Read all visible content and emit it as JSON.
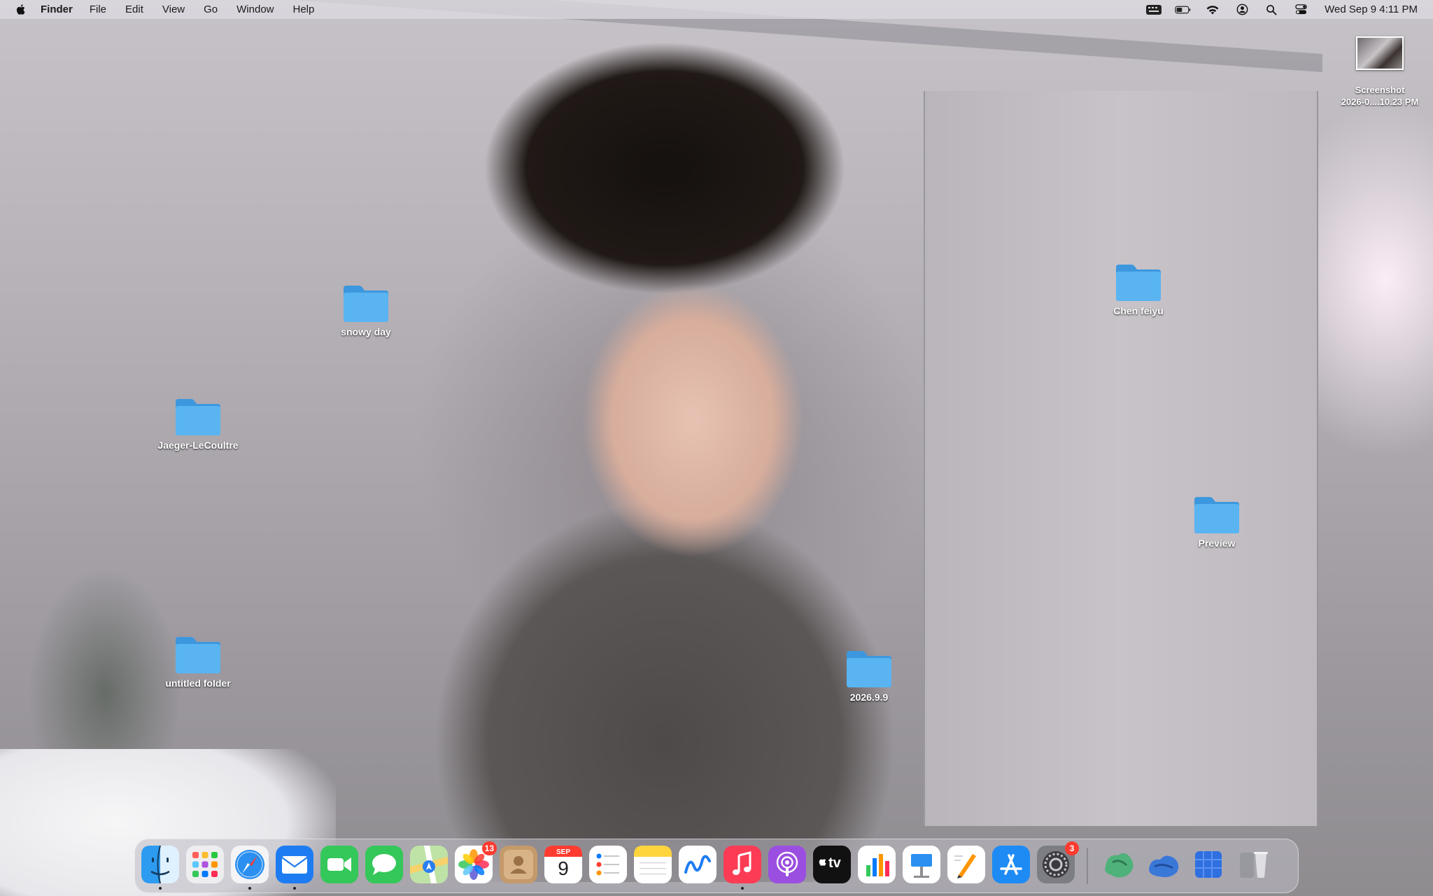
{
  "menubar": {
    "apple_icon": "apple-logo-icon",
    "app_name": "Finder",
    "menus": [
      "File",
      "Edit",
      "View",
      "Go",
      "Window",
      "Help"
    ],
    "status_icons": [
      "keyboard-input-icon",
      "battery-icon",
      "wifi-icon",
      "user-icon",
      "spotlight-search-icon",
      "control-center-icon"
    ],
    "clock": "Wed Sep 9  4:11 PM"
  },
  "desktop": {
    "items": [
      {
        "label": "snowy day",
        "kind": "folder"
      },
      {
        "label": "Jaeger-LeCoultre",
        "kind": "folder"
      },
      {
        "label": "untitled folder",
        "kind": "folder"
      },
      {
        "label": "2026.9.9",
        "kind": "folder"
      },
      {
        "label": "Chen feiyu",
        "kind": "folder"
      },
      {
        "label": "Preview",
        "kind": "folder"
      },
      {
        "label": "Screenshot",
        "label_line2": "2026-0....10.23 PM",
        "kind": "image"
      }
    ]
  },
  "dock": {
    "apps": [
      {
        "name": "finder-icon",
        "running": true
      },
      {
        "name": "launchpad-icon",
        "running": false
      },
      {
        "name": "safari-icon",
        "running": true
      },
      {
        "name": "mail-icon",
        "running": true
      },
      {
        "name": "facetime-icon",
        "running": false
      },
      {
        "name": "messages-icon",
        "running": false
      },
      {
        "name": "maps-icon",
        "running": false
      },
      {
        "name": "photos-icon",
        "running": false,
        "badge": "13"
      },
      {
        "name": "contacts-icon",
        "running": false
      },
      {
        "name": "calendar-icon",
        "running": false,
        "month": "SEP",
        "day": "9"
      },
      {
        "name": "reminders-icon",
        "running": false
      },
      {
        "name": "notes-icon",
        "running": false
      },
      {
        "name": "freeform-icon",
        "running": false
      },
      {
        "name": "music-icon",
        "running": true
      },
      {
        "name": "podcasts-icon",
        "running": false
      },
      {
        "name": "apple-tv-icon",
        "running": false,
        "text": "tv"
      },
      {
        "name": "numbers-icon",
        "running": false
      },
      {
        "name": "keynote-icon",
        "running": false
      },
      {
        "name": "pages-icon",
        "running": false
      },
      {
        "name": "app-store-icon",
        "running": false
      },
      {
        "name": "system-settings-icon",
        "running": false,
        "badge": "3"
      },
      {
        "name": "minimized-window-1-icon",
        "running": false
      },
      {
        "name": "minimized-window-2-icon",
        "running": false
      },
      {
        "name": "minimized-window-3-icon",
        "running": false
      },
      {
        "name": "trash-icon",
        "running": false
      }
    ]
  },
  "colors": {
    "folder": "#5ab4f2",
    "badge": "#ff3b30",
    "menubar_bg": "#dcdae0"
  }
}
